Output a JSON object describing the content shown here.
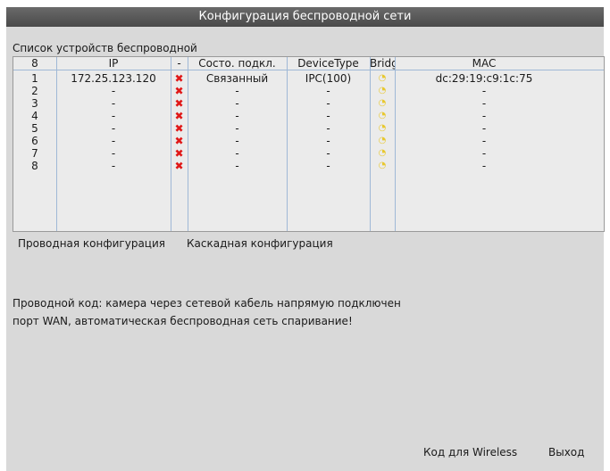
{
  "window": {
    "title": "Конфигурация беспроводной сети"
  },
  "device_list": {
    "caption": "Список устройств беспроводной",
    "columns": [
      "8",
      "IP",
      "-",
      "Состо. подкл.",
      "DeviceType",
      "Bridge",
      "MAC"
    ],
    "rows": [
      {
        "num": "1",
        "ip": "172.25.123.120",
        "state": "Связанный",
        "type": "IPC(100)",
        "mac": "dc:29:19:c9:1c:75"
      },
      {
        "num": "2",
        "ip": "-",
        "state": "-",
        "type": "-",
        "mac": "-"
      },
      {
        "num": "3",
        "ip": "-",
        "state": "-",
        "type": "-",
        "mac": "-"
      },
      {
        "num": "4",
        "ip": "-",
        "state": "-",
        "type": "-",
        "mac": "-"
      },
      {
        "num": "5",
        "ip": "-",
        "state": "-",
        "type": "-",
        "mac": "-"
      },
      {
        "num": "6",
        "ip": "-",
        "state": "-",
        "type": "-",
        "mac": "-"
      },
      {
        "num": "7",
        "ip": "-",
        "state": "-",
        "type": "-",
        "mac": "-"
      },
      {
        "num": "8",
        "ip": "-",
        "state": "-",
        "type": "-",
        "mac": "-"
      }
    ],
    "x_mark": "✖",
    "bridge_mark": "◔"
  },
  "tabs": {
    "wired": "Проводная конфигурация",
    "cascade": "Каскадная конфигурация"
  },
  "note": {
    "line1": "Проводной код: камера через сетевой кабель напрямую подключен",
    "line2": "порт WAN, автоматическая беспроводная сеть спаривание!"
  },
  "buttons": {
    "wireless_code": "Код для Wireless",
    "exit": "Выход"
  },
  "colors": {
    "panel": "#d9d9d9",
    "titlebar": "#555555",
    "grid_line": "#9fb8d6",
    "disconnect_mark": "#e01818",
    "bridge_icon": "#e8c830"
  }
}
